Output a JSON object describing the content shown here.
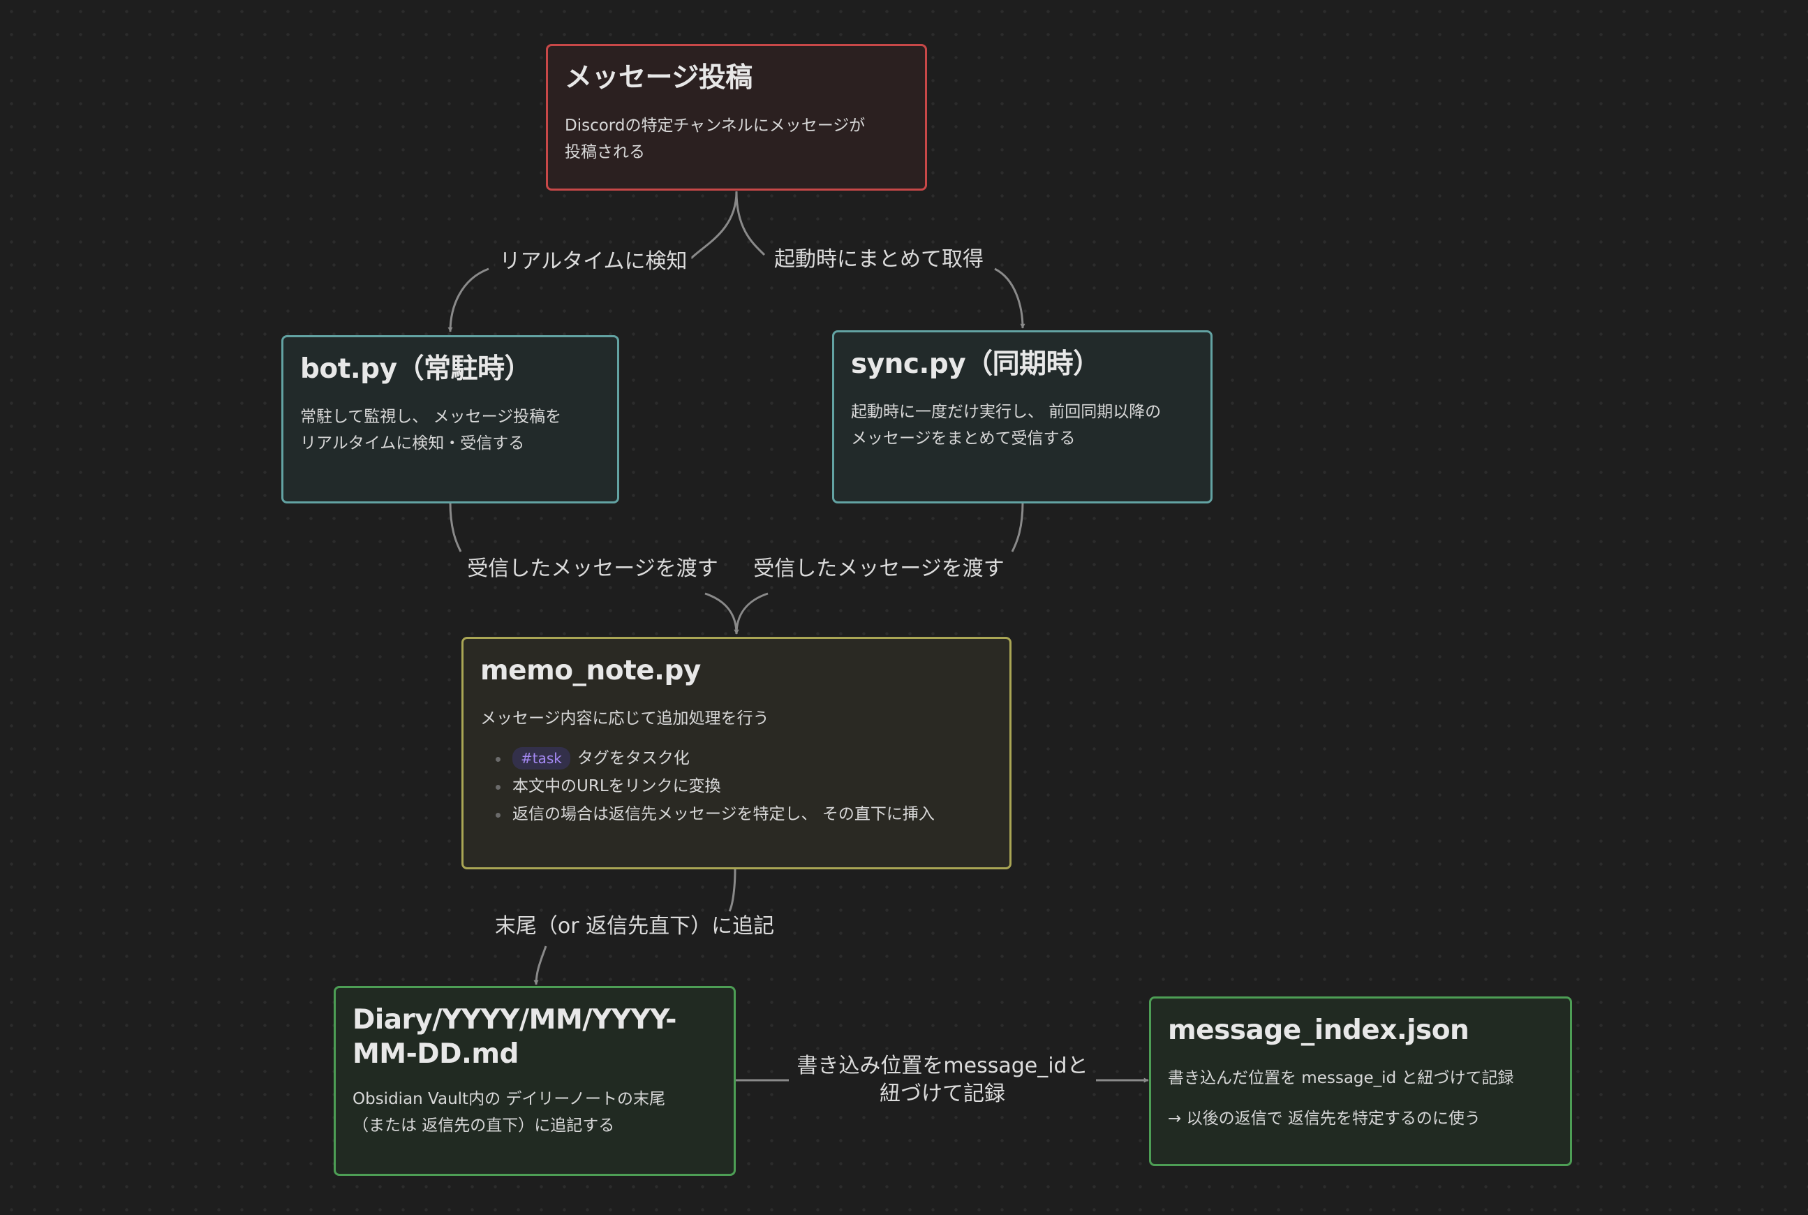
{
  "nodes": {
    "message_post": {
      "title": "メッセージ投稿",
      "desc": "Discordの特定チャンネルにメッセージが\n投稿される"
    },
    "bot": {
      "title": "bot.py（常駐時）",
      "desc": "常駐して監視し、 メッセージ投稿を\nリアルタイムに検知・受信する"
    },
    "sync": {
      "title": "sync.py（同期時）",
      "desc": "起動時に一度だけ実行し、 前回同期以降の\nメッセージをまとめて受信する"
    },
    "memo_note": {
      "title": "memo_note.py",
      "desc": "メッセージ内容に応じて追加処理を行う",
      "items": [
        {
          "tag": "#task",
          "text": "タグをタスク化"
        },
        {
          "tag": "",
          "text": "本文中のURLをリンクに変換"
        },
        {
          "tag": "",
          "text": "返信の場合は返信先メッセージを特定し、 その直下に挿入"
        }
      ]
    },
    "diary": {
      "title": "Diary/YYYY/MM/YYYY-\nMM-DD.md",
      "desc": "Obsidian Vault内の デイリーノートの末尾\n（または 返信先の直下）に追記する"
    },
    "message_index": {
      "title": "message_index.json",
      "desc": "書き込んだ位置を message_id と紐づけて記録",
      "note": "→ 以後の返信で 返信先を特定するのに使う"
    }
  },
  "edges": {
    "realtime": "リアルタイムに検知",
    "startup": "起動時にまとめて取得",
    "pass_bot": "受信したメッセージを渡す",
    "pass_sync": "受信したメッセージを渡す",
    "append": "末尾（or 返信先直下）に追記",
    "record": "書き込み位置をmessage_idと\n紐づけて記録"
  },
  "colors": {
    "red": "#c84848",
    "teal": "#63a3a3",
    "yellow": "#aaa655",
    "green": "#4d9e55",
    "edge": "#8a8a8a",
    "tag_text": "#a68af5"
  }
}
